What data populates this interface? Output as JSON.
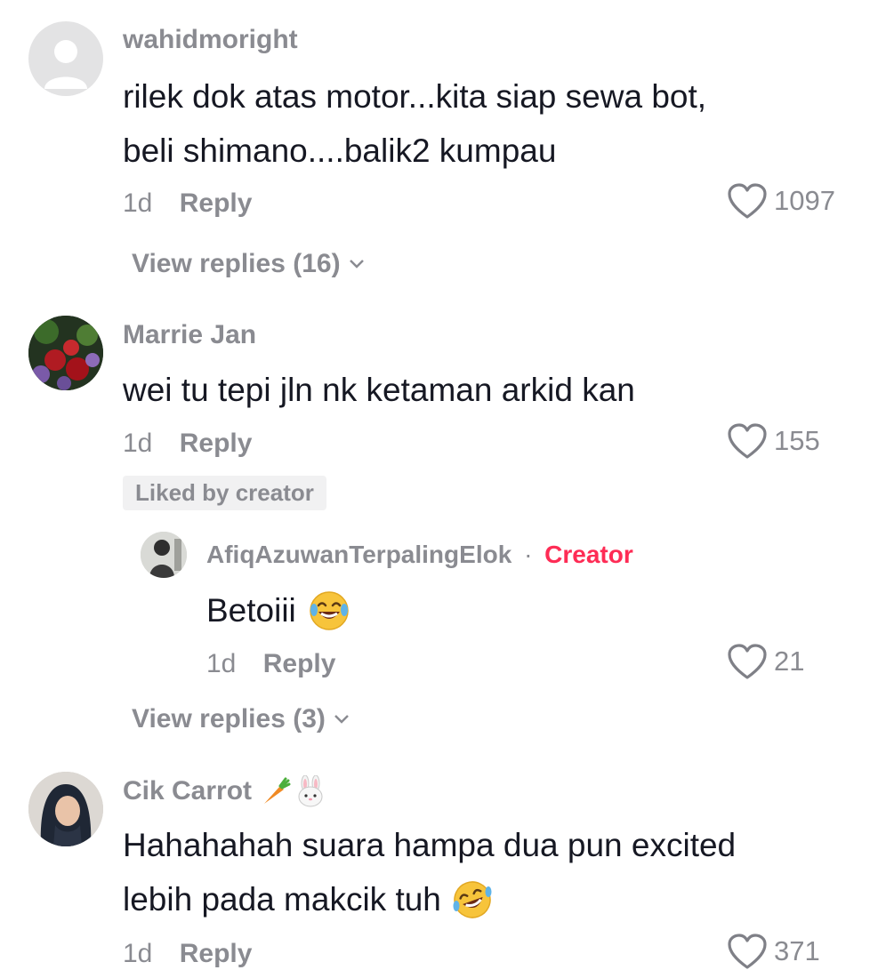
{
  "comments": [
    {
      "username": "wahidmoright",
      "text_lines": [
        "rilek dok atas motor...kita siap sewa bot,",
        "beli shimano....balik2 kumpau"
      ],
      "time": "1d",
      "reply_label": "Reply",
      "likes": "1097",
      "view_replies": "View replies (16)"
    },
    {
      "username": "Marrie Jan",
      "text_lines": [
        "wei tu tepi jln nk ketaman arkid kan"
      ],
      "time": "1d",
      "reply_label": "Reply",
      "likes": "155",
      "badge": "Liked by creator",
      "reply": {
        "username": "AfiqAzuwanTerpalingElok",
        "separator": "·",
        "creator_label": "Creator",
        "text": "Betoiii",
        "time": "1d",
        "reply_label": "Reply",
        "likes": "21"
      },
      "view_replies": "View replies (3)"
    },
    {
      "username": "Cik Carrot",
      "username_emojis": [
        "carrot-emoji",
        "rabbit-emoji"
      ],
      "text_lines": [
        "Hahahahah suara hampa dua pun excited",
        "lebih pada makcik tuh"
      ],
      "text_emoji": "rofl-emoji",
      "time": "1d",
      "reply_label": "Reply",
      "likes": "371"
    }
  ],
  "colors": {
    "text": "#161823",
    "secondary": "#8a8b91",
    "creator": "#fe2c55",
    "badge_bg": "#f1f1f2"
  },
  "icons": [
    "heart-outline-icon",
    "chevron-down-icon",
    "default-avatar-icon"
  ]
}
